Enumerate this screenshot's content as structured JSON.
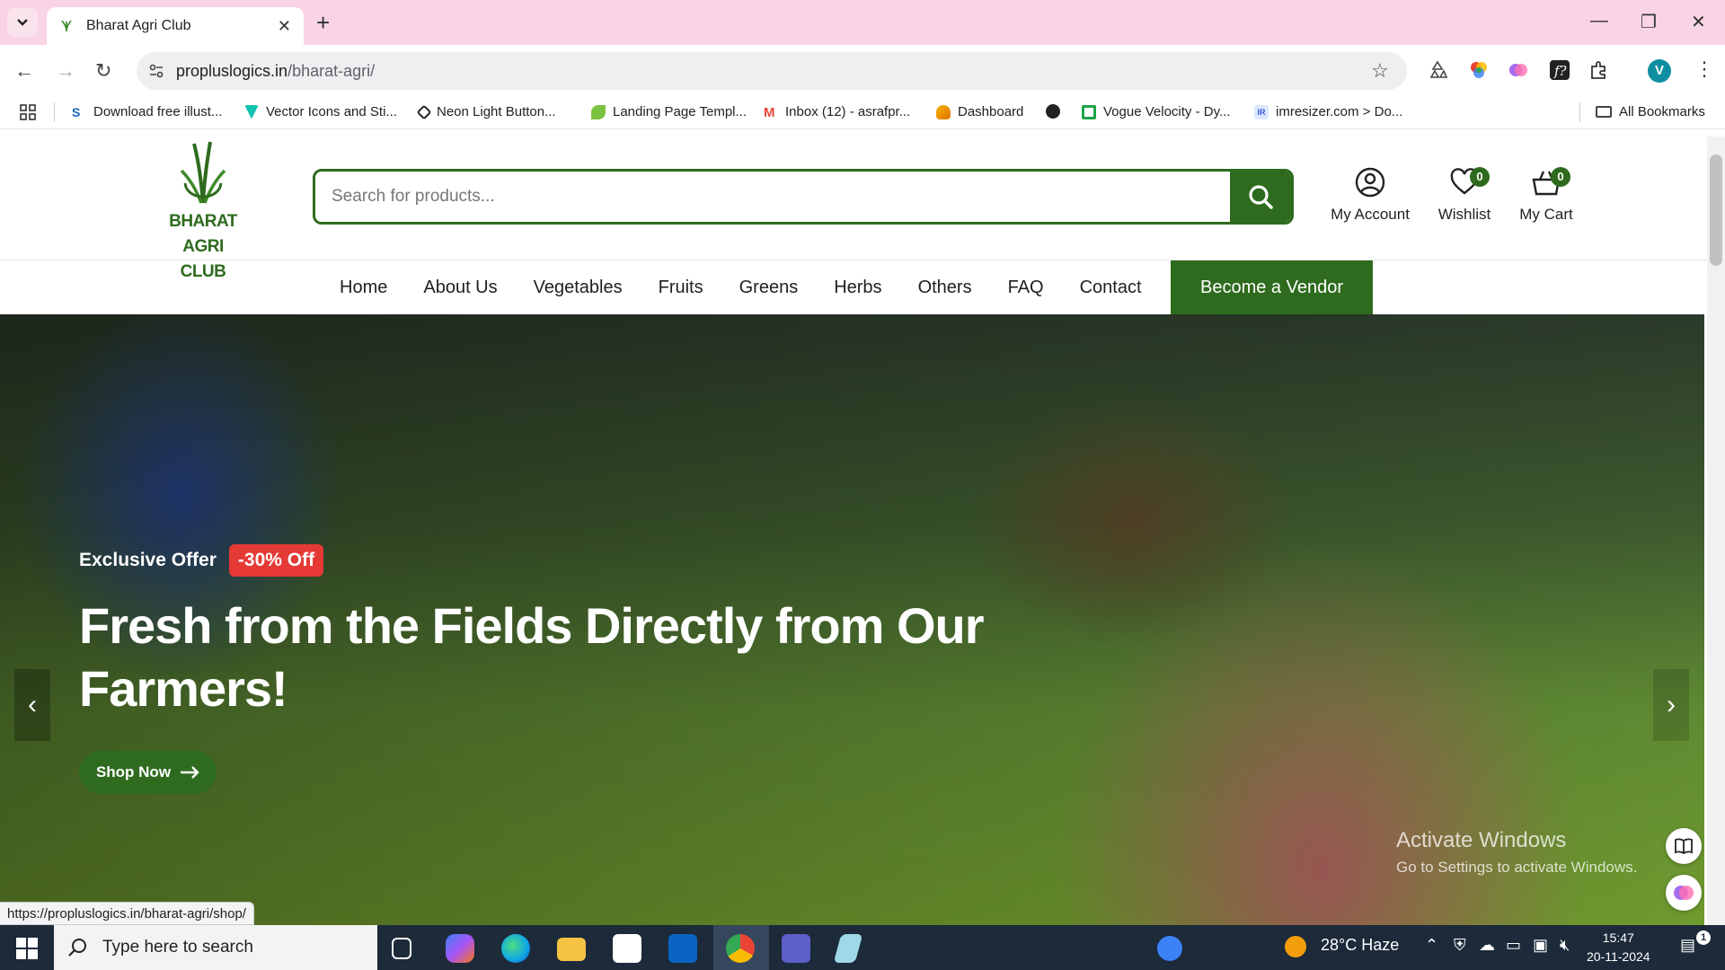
{
  "browser": {
    "tab_title": "Bharat Agri Club",
    "url_host": "propluslogics.in",
    "url_path": "/bharat-agri/",
    "status_url": "https://propluslogics.in/bharat-agri/shop/",
    "profile_initial": "V",
    "all_bookmarks": "All Bookmarks",
    "bookmarks": [
      {
        "label": "Download free illust...",
        "icon": "s-logo-icon"
      },
      {
        "label": "Vector Icons and Sti...",
        "icon": "flaticon-icon"
      },
      {
        "label": "Neon Light Button...",
        "icon": "codepen-icon"
      },
      {
        "label": "Landing Page Templ...",
        "icon": "leaf-icon"
      },
      {
        "label": "Inbox (12) - asrafpr...",
        "icon": "gmail-icon"
      },
      {
        "label": "Dashboard",
        "icon": "dashboard-icon"
      },
      {
        "label": "Vogue Velocity - Dy...",
        "icon": "vogue-icon"
      },
      {
        "label": "imresizer.com > Do...",
        "icon": "imresizer-icon"
      }
    ]
  },
  "site": {
    "logo_line1": "BHARAT AGRI",
    "logo_line2": "CLUB",
    "search_placeholder": "Search for products...",
    "account_label": "My Account",
    "wishlist_label": "Wishlist",
    "wishlist_count": "0",
    "cart_label": "My Cart",
    "cart_count": "0",
    "menu": [
      "Home",
      "About Us",
      "Vegetables",
      "Fruits",
      "Greens",
      "Herbs",
      "Others",
      "FAQ",
      "Contact"
    ],
    "vendor_button": "Become a Vendor",
    "accent_color": "#2e6b1e"
  },
  "hero": {
    "offer_label": "Exclusive Offer",
    "offer_badge": "-30% Off",
    "headline": "Fresh from the Fields Directly from Our Farmers!",
    "cta": "Shop Now"
  },
  "watermark": {
    "line1": "Activate Windows",
    "line2": "Go to Settings to activate Windows."
  },
  "taskbar": {
    "search_placeholder": "Type here to search",
    "weather": "28°C  Haze",
    "time": "15:47",
    "date": "20-11-2024",
    "notifications": "1"
  }
}
